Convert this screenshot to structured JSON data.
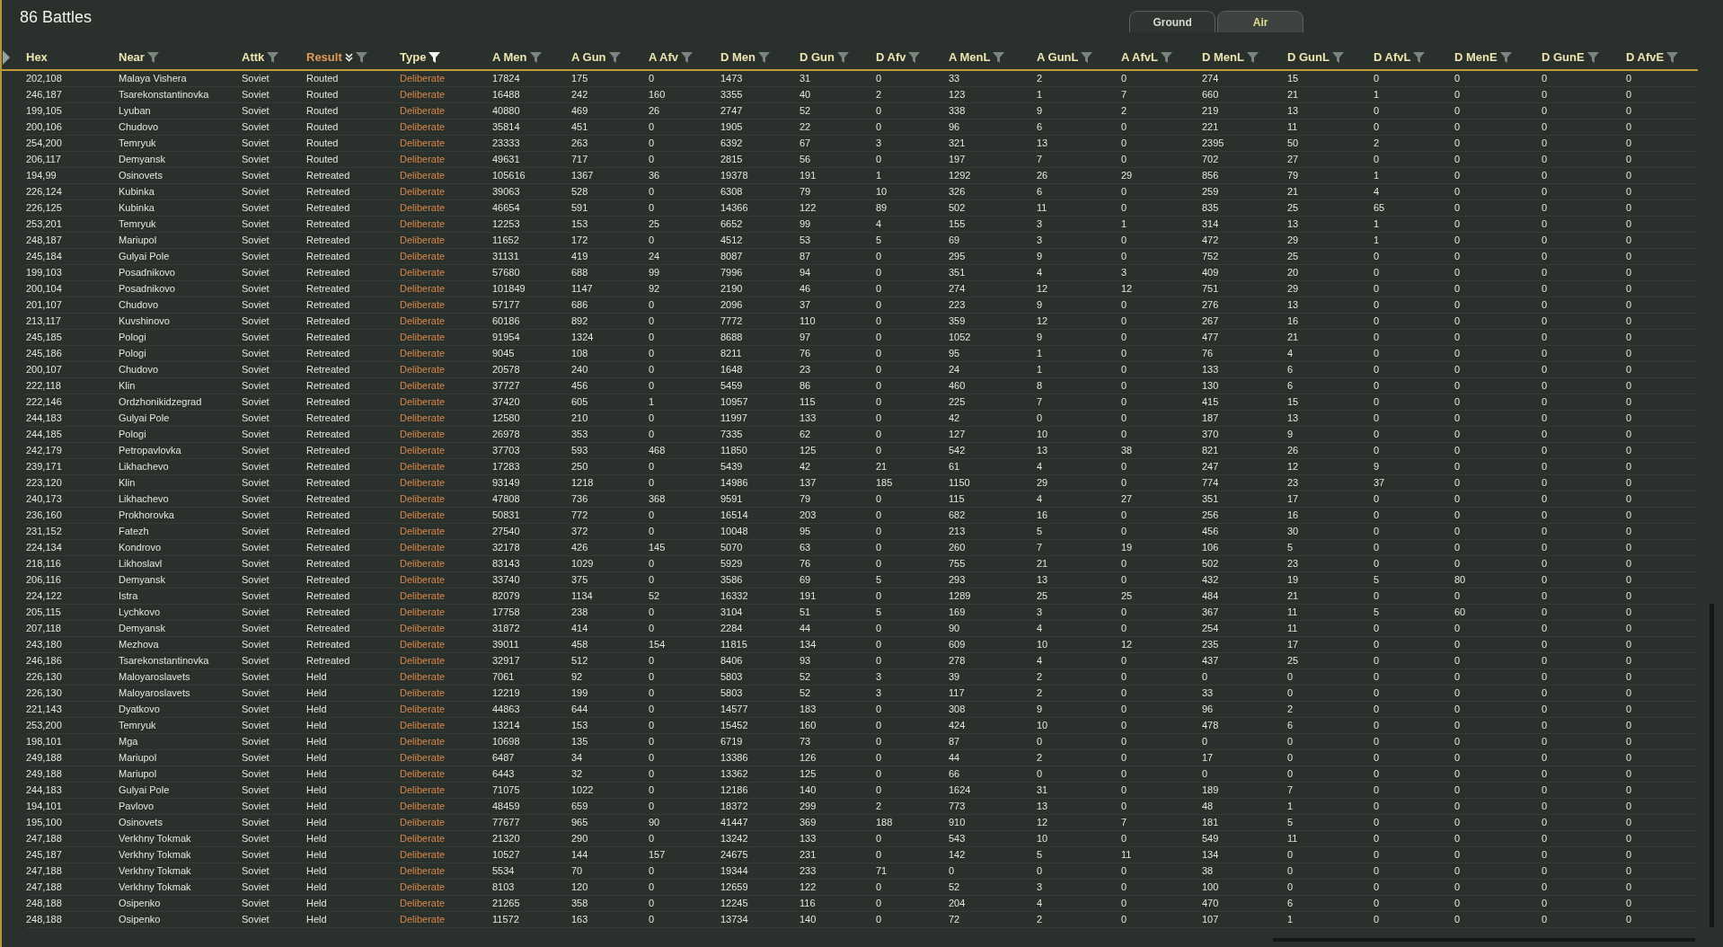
{
  "title": "86 Battles",
  "tabs": [
    {
      "label": "Ground",
      "selected": true
    },
    {
      "label": "Air",
      "selected": false
    }
  ],
  "columns": [
    {
      "label": "Hex",
      "filterable": false,
      "filter_active": false,
      "sorted": false,
      "kind": "plain"
    },
    {
      "label": "Near",
      "filterable": true,
      "filter_active": false,
      "sorted": false,
      "kind": "plain"
    },
    {
      "label": "Attk",
      "filterable": true,
      "filter_active": false,
      "sorted": false,
      "kind": "plain"
    },
    {
      "label": "Result",
      "filterable": true,
      "filter_active": false,
      "sorted": true,
      "kind": "plain"
    },
    {
      "label": "Type",
      "filterable": true,
      "filter_active": true,
      "sorted": false,
      "kind": "highlight"
    },
    {
      "label": "A Men",
      "filterable": true,
      "filter_active": false,
      "sorted": false,
      "kind": "plain"
    },
    {
      "label": "A Gun",
      "filterable": true,
      "filter_active": false,
      "sorted": false,
      "kind": "plain"
    },
    {
      "label": "A Afv",
      "filterable": true,
      "filter_active": false,
      "sorted": false,
      "kind": "plain"
    },
    {
      "label": "D Men",
      "filterable": true,
      "filter_active": false,
      "sorted": false,
      "kind": "plain"
    },
    {
      "label": "D Gun",
      "filterable": true,
      "filter_active": false,
      "sorted": false,
      "kind": "plain"
    },
    {
      "label": "D Afv",
      "filterable": true,
      "filter_active": false,
      "sorted": false,
      "kind": "plain"
    },
    {
      "label": "A MenL",
      "filterable": true,
      "filter_active": false,
      "sorted": false,
      "kind": "plain"
    },
    {
      "label": "A GunL",
      "filterable": true,
      "filter_active": false,
      "sorted": false,
      "kind": "plain"
    },
    {
      "label": "A AfvL",
      "filterable": true,
      "filter_active": false,
      "sorted": false,
      "kind": "plain"
    },
    {
      "label": "D MenL",
      "filterable": true,
      "filter_active": false,
      "sorted": false,
      "kind": "plain"
    },
    {
      "label": "D GunL",
      "filterable": true,
      "filter_active": false,
      "sorted": false,
      "kind": "plain"
    },
    {
      "label": "D AfvL",
      "filterable": true,
      "filter_active": false,
      "sorted": false,
      "kind": "plain"
    },
    {
      "label": "D MenE",
      "filterable": true,
      "filter_active": false,
      "sorted": false,
      "kind": "plain"
    },
    {
      "label": "D GunE",
      "filterable": true,
      "filter_active": false,
      "sorted": false,
      "kind": "plain"
    },
    {
      "label": "D AfvE",
      "filterable": true,
      "filter_active": false,
      "sorted": false,
      "kind": "plain"
    }
  ],
  "rows": [
    {
      "cells": [
        "202,108",
        "Malaya Vishera",
        "Soviet",
        "Routed",
        "Deliberate",
        "17824",
        "175",
        "0",
        "1473",
        "31",
        "0",
        "33",
        "2",
        "0",
        "274",
        "15",
        "0",
        "0",
        "0",
        "0"
      ]
    },
    {
      "cells": [
        "246,187",
        "Tsarekonstantinovka",
        "Soviet",
        "Routed",
        "Deliberate",
        "16488",
        "242",
        "160",
        "3355",
        "40",
        "2",
        "123",
        "1",
        "7",
        "660",
        "21",
        "1",
        "0",
        "0",
        "0"
      ]
    },
    {
      "cells": [
        "199,105",
        "Lyuban",
        "Soviet",
        "Routed",
        "Deliberate",
        "40880",
        "469",
        "26",
        "2747",
        "52",
        "0",
        "338",
        "9",
        "2",
        "219",
        "13",
        "0",
        "0",
        "0",
        "0"
      ]
    },
    {
      "cells": [
        "200,106",
        "Chudovo",
        "Soviet",
        "Routed",
        "Deliberate",
        "35814",
        "451",
        "0",
        "1905",
        "22",
        "0",
        "96",
        "6",
        "0",
        "221",
        "11",
        "0",
        "0",
        "0",
        "0"
      ]
    },
    {
      "cells": [
        "254,200",
        "Temryuk",
        "Soviet",
        "Routed",
        "Deliberate",
        "23333",
        "263",
        "0",
        "6392",
        "67",
        "3",
        "321",
        "13",
        "0",
        "2395",
        "50",
        "2",
        "0",
        "0",
        "0"
      ]
    },
    {
      "cells": [
        "206,117",
        "Demyansk",
        "Soviet",
        "Routed",
        "Deliberate",
        "49631",
        "717",
        "0",
        "2815",
        "56",
        "0",
        "197",
        "7",
        "0",
        "702",
        "27",
        "0",
        "0",
        "0",
        "0"
      ]
    },
    {
      "cells": [
        "194,99",
        "Osinovets",
        "Soviet",
        "Retreated",
        "Deliberate",
        "105616",
        "1367",
        "36",
        "19378",
        "191",
        "1",
        "1292",
        "26",
        "29",
        "856",
        "79",
        "1",
        "0",
        "0",
        "0"
      ]
    },
    {
      "cells": [
        "226,124",
        "Kubinka",
        "Soviet",
        "Retreated",
        "Deliberate",
        "39063",
        "528",
        "0",
        "6308",
        "79",
        "10",
        "326",
        "6",
        "0",
        "259",
        "21",
        "4",
        "0",
        "0",
        "0"
      ]
    },
    {
      "cells": [
        "226,125",
        "Kubinka",
        "Soviet",
        "Retreated",
        "Deliberate",
        "46654",
        "591",
        "0",
        "14366",
        "122",
        "89",
        "502",
        "11",
        "0",
        "835",
        "25",
        "65",
        "0",
        "0",
        "0"
      ]
    },
    {
      "cells": [
        "253,201",
        "Temryuk",
        "Soviet",
        "Retreated",
        "Deliberate",
        "12253",
        "153",
        "25",
        "6652",
        "99",
        "4",
        "155",
        "3",
        "1",
        "314",
        "13",
        "1",
        "0",
        "0",
        "0"
      ]
    },
    {
      "cells": [
        "248,187",
        "Mariupol",
        "Soviet",
        "Retreated",
        "Deliberate",
        "11652",
        "172",
        "0",
        "4512",
        "53",
        "5",
        "69",
        "3",
        "0",
        "472",
        "29",
        "1",
        "0",
        "0",
        "0"
      ]
    },
    {
      "cells": [
        "245,184",
        "Gulyai Pole",
        "Soviet",
        "Retreated",
        "Deliberate",
        "31131",
        "419",
        "24",
        "8087",
        "87",
        "0",
        "295",
        "9",
        "0",
        "752",
        "25",
        "0",
        "0",
        "0",
        "0"
      ]
    },
    {
      "cells": [
        "199,103",
        "Posadnikovo",
        "Soviet",
        "Retreated",
        "Deliberate",
        "57680",
        "688",
        "99",
        "7996",
        "94",
        "0",
        "351",
        "4",
        "3",
        "409",
        "20",
        "0",
        "0",
        "0",
        "0"
      ]
    },
    {
      "cells": [
        "200,104",
        "Posadnikovo",
        "Soviet",
        "Retreated",
        "Deliberate",
        "101849",
        "1147",
        "92",
        "2190",
        "46",
        "0",
        "274",
        "12",
        "12",
        "751",
        "29",
        "0",
        "0",
        "0",
        "0"
      ]
    },
    {
      "cells": [
        "201,107",
        "Chudovo",
        "Soviet",
        "Retreated",
        "Deliberate",
        "57177",
        "686",
        "0",
        "2096",
        "37",
        "0",
        "223",
        "9",
        "0",
        "276",
        "13",
        "0",
        "0",
        "0",
        "0"
      ]
    },
    {
      "cells": [
        "213,117",
        "Kuvshinovo",
        "Soviet",
        "Retreated",
        "Deliberate",
        "60186",
        "892",
        "0",
        "7772",
        "110",
        "0",
        "359",
        "12",
        "0",
        "267",
        "16",
        "0",
        "0",
        "0",
        "0"
      ]
    },
    {
      "cells": [
        "245,185",
        "Pologi",
        "Soviet",
        "Retreated",
        "Deliberate",
        "91954",
        "1324",
        "0",
        "8688",
        "97",
        "0",
        "1052",
        "9",
        "0",
        "477",
        "21",
        "0",
        "0",
        "0",
        "0"
      ]
    },
    {
      "cells": [
        "245,186",
        "Pologi",
        "Soviet",
        "Retreated",
        "Deliberate",
        "9045",
        "108",
        "0",
        "8211",
        "76",
        "0",
        "95",
        "1",
        "0",
        "76",
        "4",
        "0",
        "0",
        "0",
        "0"
      ]
    },
    {
      "cells": [
        "200,107",
        "Chudovo",
        "Soviet",
        "Retreated",
        "Deliberate",
        "20578",
        "240",
        "0",
        "1648",
        "23",
        "0",
        "24",
        "1",
        "0",
        "133",
        "6",
        "0",
        "0",
        "0",
        "0"
      ]
    },
    {
      "cells": [
        "222,118",
        "Klin",
        "Soviet",
        "Retreated",
        "Deliberate",
        "37727",
        "456",
        "0",
        "5459",
        "86",
        "0",
        "460",
        "8",
        "0",
        "130",
        "6",
        "0",
        "0",
        "0",
        "0"
      ]
    },
    {
      "cells": [
        "222,146",
        "Ordzhonikidzegrad",
        "Soviet",
        "Retreated",
        "Deliberate",
        "37420",
        "605",
        "1",
        "10957",
        "115",
        "0",
        "225",
        "7",
        "0",
        "415",
        "15",
        "0",
        "0",
        "0",
        "0"
      ]
    },
    {
      "cells": [
        "244,183",
        "Gulyai Pole",
        "Soviet",
        "Retreated",
        "Deliberate",
        "12580",
        "210",
        "0",
        "11997",
        "133",
        "0",
        "42",
        "0",
        "0",
        "187",
        "13",
        "0",
        "0",
        "0",
        "0"
      ]
    },
    {
      "cells": [
        "244,185",
        "Pologi",
        "Soviet",
        "Retreated",
        "Deliberate",
        "26978",
        "353",
        "0",
        "7335",
        "62",
        "0",
        "127",
        "10",
        "0",
        "370",
        "9",
        "0",
        "0",
        "0",
        "0"
      ]
    },
    {
      "cells": [
        "242,179",
        "Petropavlovka",
        "Soviet",
        "Retreated",
        "Deliberate",
        "37703",
        "593",
        "468",
        "11850",
        "125",
        "0",
        "542",
        "13",
        "38",
        "821",
        "26",
        "0",
        "0",
        "0",
        "0"
      ]
    },
    {
      "cells": [
        "239,171",
        "Likhachevo",
        "Soviet",
        "Retreated",
        "Deliberate",
        "17283",
        "250",
        "0",
        "5439",
        "42",
        "21",
        "61",
        "4",
        "0",
        "247",
        "12",
        "9",
        "0",
        "0",
        "0"
      ]
    },
    {
      "cells": [
        "223,120",
        "Klin",
        "Soviet",
        "Retreated",
        "Deliberate",
        "93149",
        "1218",
        "0",
        "14986",
        "137",
        "185",
        "1150",
        "29",
        "0",
        "774",
        "23",
        "37",
        "0",
        "0",
        "0"
      ]
    },
    {
      "cells": [
        "240,173",
        "Likhachevo",
        "Soviet",
        "Retreated",
        "Deliberate",
        "47808",
        "736",
        "368",
        "9591",
        "79",
        "0",
        "115",
        "4",
        "27",
        "351",
        "17",
        "0",
        "0",
        "0",
        "0"
      ]
    },
    {
      "cells": [
        "236,160",
        "Prokhorovka",
        "Soviet",
        "Retreated",
        "Deliberate",
        "50831",
        "772",
        "0",
        "16514",
        "203",
        "0",
        "682",
        "16",
        "0",
        "256",
        "16",
        "0",
        "0",
        "0",
        "0"
      ]
    },
    {
      "cells": [
        "231,152",
        "Fatezh",
        "Soviet",
        "Retreated",
        "Deliberate",
        "27540",
        "372",
        "0",
        "10048",
        "95",
        "0",
        "213",
        "5",
        "0",
        "456",
        "30",
        "0",
        "0",
        "0",
        "0"
      ]
    },
    {
      "cells": [
        "224,134",
        "Kondrovo",
        "Soviet",
        "Retreated",
        "Deliberate",
        "32178",
        "426",
        "145",
        "5070",
        "63",
        "0",
        "260",
        "7",
        "19",
        "106",
        "5",
        "0",
        "0",
        "0",
        "0"
      ]
    },
    {
      "cells": [
        "218,116",
        "Likhoslavl",
        "Soviet",
        "Retreated",
        "Deliberate",
        "83143",
        "1029",
        "0",
        "5929",
        "76",
        "0",
        "755",
        "21",
        "0",
        "502",
        "23",
        "0",
        "0",
        "0",
        "0"
      ]
    },
    {
      "cells": [
        "206,116",
        "Demyansk",
        "Soviet",
        "Retreated",
        "Deliberate",
        "33740",
        "375",
        "0",
        "3586",
        "69",
        "5",
        "293",
        "13",
        "0",
        "432",
        "19",
        "5",
        "80",
        "0",
        "0"
      ]
    },
    {
      "cells": [
        "224,122",
        "Istra",
        "Soviet",
        "Retreated",
        "Deliberate",
        "82079",
        "1134",
        "52",
        "16332",
        "191",
        "0",
        "1289",
        "25",
        "25",
        "484",
        "21",
        "0",
        "0",
        "0",
        "0"
      ]
    },
    {
      "cells": [
        "205,115",
        "Lychkovo",
        "Soviet",
        "Retreated",
        "Deliberate",
        "17758",
        "238",
        "0",
        "3104",
        "51",
        "5",
        "169",
        "3",
        "0",
        "367",
        "11",
        "5",
        "60",
        "0",
        "0"
      ]
    },
    {
      "cells": [
        "207,118",
        "Demyansk",
        "Soviet",
        "Retreated",
        "Deliberate",
        "31872",
        "414",
        "0",
        "2284",
        "44",
        "0",
        "90",
        "4",
        "0",
        "254",
        "11",
        "0",
        "0",
        "0",
        "0"
      ]
    },
    {
      "cells": [
        "243,180",
        "Mezhova",
        "Soviet",
        "Retreated",
        "Deliberate",
        "39011",
        "458",
        "154",
        "11815",
        "134",
        "0",
        "609",
        "10",
        "12",
        "235",
        "17",
        "0",
        "0",
        "0",
        "0"
      ]
    },
    {
      "cells": [
        "246,186",
        "Tsarekonstantinovka",
        "Soviet",
        "Retreated",
        "Deliberate",
        "32917",
        "512",
        "0",
        "8406",
        "93",
        "0",
        "278",
        "4",
        "0",
        "437",
        "25",
        "0",
        "0",
        "0",
        "0"
      ]
    },
    {
      "cells": [
        "226,130",
        "Maloyaroslavets",
        "Soviet",
        "Held",
        "Deliberate",
        "7061",
        "92",
        "0",
        "5803",
        "52",
        "3",
        "39",
        "2",
        "0",
        "0",
        "0",
        "0",
        "0",
        "0",
        "0"
      ]
    },
    {
      "cells": [
        "226,130",
        "Maloyaroslavets",
        "Soviet",
        "Held",
        "Deliberate",
        "12219",
        "199",
        "0",
        "5803",
        "52",
        "3",
        "117",
        "2",
        "0",
        "33",
        "0",
        "0",
        "0",
        "0",
        "0"
      ]
    },
    {
      "cells": [
        "221,143",
        "Dyatkovo",
        "Soviet",
        "Held",
        "Deliberate",
        "44863",
        "644",
        "0",
        "14577",
        "183",
        "0",
        "308",
        "9",
        "0",
        "96",
        "2",
        "0",
        "0",
        "0",
        "0"
      ]
    },
    {
      "cells": [
        "253,200",
        "Temryuk",
        "Soviet",
        "Held",
        "Deliberate",
        "13214",
        "153",
        "0",
        "15452",
        "160",
        "0",
        "424",
        "10",
        "0",
        "478",
        "6",
        "0",
        "0",
        "0",
        "0"
      ]
    },
    {
      "cells": [
        "198,101",
        "Mga",
        "Soviet",
        "Held",
        "Deliberate",
        "10698",
        "135",
        "0",
        "6719",
        "73",
        "0",
        "87",
        "0",
        "0",
        "0",
        "0",
        "0",
        "0",
        "0",
        "0"
      ]
    },
    {
      "cells": [
        "249,188",
        "Mariupol",
        "Soviet",
        "Held",
        "Deliberate",
        "6487",
        "34",
        "0",
        "13386",
        "126",
        "0",
        "44",
        "2",
        "0",
        "17",
        "0",
        "0",
        "0",
        "0",
        "0"
      ]
    },
    {
      "cells": [
        "249,188",
        "Mariupol",
        "Soviet",
        "Held",
        "Deliberate",
        "6443",
        "32",
        "0",
        "13362",
        "125",
        "0",
        "66",
        "0",
        "0",
        "0",
        "0",
        "0",
        "0",
        "0",
        "0"
      ]
    },
    {
      "cells": [
        "244,183",
        "Gulyai Pole",
        "Soviet",
        "Held",
        "Deliberate",
        "71075",
        "1022",
        "0",
        "12186",
        "140",
        "0",
        "1624",
        "31",
        "0",
        "189",
        "7",
        "0",
        "0",
        "0",
        "0"
      ]
    },
    {
      "cells": [
        "194,101",
        "Pavlovo",
        "Soviet",
        "Held",
        "Deliberate",
        "48459",
        "659",
        "0",
        "18372",
        "299",
        "2",
        "773",
        "13",
        "0",
        "48",
        "1",
        "0",
        "0",
        "0",
        "0"
      ]
    },
    {
      "cells": [
        "195,100",
        "Osinovets",
        "Soviet",
        "Held",
        "Deliberate",
        "77677",
        "965",
        "90",
        "41447",
        "369",
        "188",
        "910",
        "12",
        "7",
        "181",
        "5",
        "0",
        "0",
        "0",
        "0"
      ]
    },
    {
      "cells": [
        "247,188",
        "Verkhny Tokmak",
        "Soviet",
        "Held",
        "Deliberate",
        "21320",
        "290",
        "0",
        "13242",
        "133",
        "0",
        "543",
        "10",
        "0",
        "549",
        "11",
        "0",
        "0",
        "0",
        "0"
      ]
    },
    {
      "cells": [
        "245,187",
        "Verkhny Tokmak",
        "Soviet",
        "Held",
        "Deliberate",
        "10527",
        "144",
        "157",
        "24675",
        "231",
        "0",
        "142",
        "5",
        "11",
        "134",
        "0",
        "0",
        "0",
        "0",
        "0"
      ]
    },
    {
      "cells": [
        "247,188",
        "Verkhny Tokmak",
        "Soviet",
        "Held",
        "Deliberate",
        "5534",
        "70",
        "0",
        "19344",
        "233",
        "71",
        "0",
        "0",
        "0",
        "38",
        "0",
        "0",
        "0",
        "0",
        "0"
      ]
    },
    {
      "cells": [
        "247,188",
        "Verkhny Tokmak",
        "Soviet",
        "Held",
        "Deliberate",
        "8103",
        "120",
        "0",
        "12659",
        "122",
        "0",
        "52",
        "3",
        "0",
        "100",
        "0",
        "0",
        "0",
        "0",
        "0"
      ]
    },
    {
      "cells": [
        "248,188",
        "Osipenko",
        "Soviet",
        "Held",
        "Deliberate",
        "21265",
        "358",
        "0",
        "12245",
        "116",
        "0",
        "204",
        "4",
        "0",
        "470",
        "6",
        "0",
        "0",
        "0",
        "0"
      ]
    },
    {
      "cells": [
        "248,188",
        "Osipenko",
        "Soviet",
        "Held",
        "Deliberate",
        "11572",
        "163",
        "0",
        "13734",
        "140",
        "0",
        "72",
        "2",
        "0",
        "107",
        "1",
        "0",
        "0",
        "0",
        "0"
      ]
    }
  ]
}
